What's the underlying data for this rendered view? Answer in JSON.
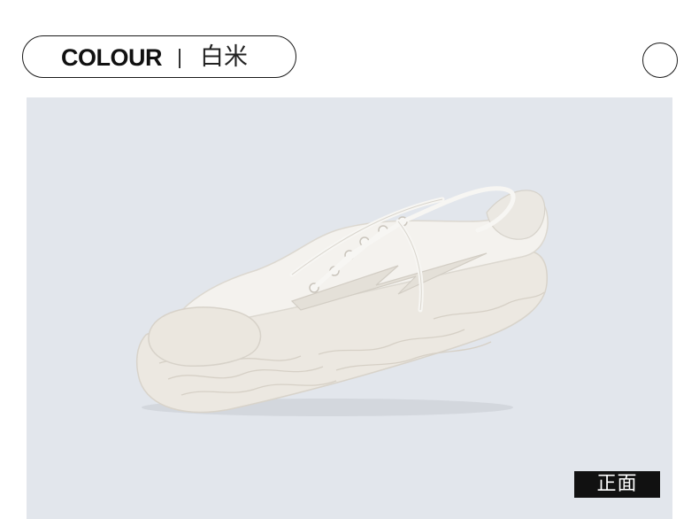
{
  "colour_header": {
    "label": "COLOUR",
    "value": "白米"
  },
  "swatch": {
    "color": "#ffffff"
  },
  "product_photo": {
    "background_color": "#e2e6ec",
    "shoe_color": "#f4f2ee"
  },
  "view_tag": {
    "label": "正面"
  }
}
